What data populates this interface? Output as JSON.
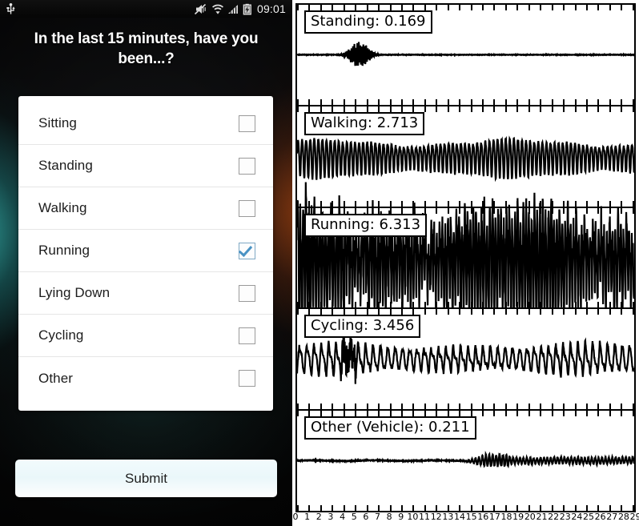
{
  "phone": {
    "statusbar": {
      "time": "09:01",
      "icons": [
        "usb-icon",
        "mute-vibrate-icon",
        "wifi-icon",
        "signal-bars-icon",
        "battery-charging-icon"
      ]
    },
    "question": "In the last 15 minutes, have you been...?",
    "options": [
      {
        "label": "Sitting",
        "checked": false
      },
      {
        "label": "Standing",
        "checked": false
      },
      {
        "label": "Walking",
        "checked": false
      },
      {
        "label": "Running",
        "checked": true
      },
      {
        "label": "Lying Down",
        "checked": false
      },
      {
        "label": "Cycling",
        "checked": false
      },
      {
        "label": "Other",
        "checked": false
      }
    ],
    "submit_label": "Submit",
    "colors": {
      "checkmark": "#4a93c4",
      "card_background": "#ffffff",
      "submit_background": "#eaf7fa",
      "accent_left_glow": "#40d6d0",
      "accent_right_glow": "#cd5414"
    }
  },
  "chart_data": {
    "type": "line",
    "title": "",
    "xlabel": "",
    "ylabel": "",
    "x_tick_labels": [
      "0",
      "1",
      "2",
      "3",
      "4",
      "5",
      "6",
      "7",
      "8",
      "9",
      "10",
      "11",
      "12",
      "13",
      "14",
      "15",
      "16",
      "17",
      "18",
      "19",
      "20",
      "21",
      "22",
      "23",
      "24",
      "25",
      "26",
      "27",
      "28",
      "29"
    ],
    "xlim": [
      0,
      29
    ],
    "grid": false,
    "legend_position": "inside-top-left-box",
    "panels": [
      {
        "label": "Standing: 0.169",
        "activity": "Standing",
        "value": 0.169,
        "waveform": "flat-with-small-burst",
        "amplitude_rel": 0.04,
        "description": "near-flat trace with a small burst of activity around x=5-6"
      },
      {
        "label": "Walking: 2.713",
        "activity": "Walking",
        "value": 2.713,
        "waveform": "regular-oscillation",
        "amplitude_rel": 0.45,
        "description": "dense regular periodic oscillation spanning the full x range"
      },
      {
        "label": "Running: 6.313",
        "activity": "Running",
        "value": 6.313,
        "waveform": "high-amplitude-dense-oscillation",
        "amplitude_rel": 1.15,
        "description": "very dense high amplitude oscillation clipping beyond panel bounds"
      },
      {
        "label": "Cycling: 3.456",
        "activity": "Cycling",
        "value": 3.456,
        "waveform": "sawtooth-like-oscillation",
        "amplitude_rel": 0.38,
        "description": "repetitive sawtooth-like pedalling signature"
      },
      {
        "label": "Other (Vehicle): 0.211",
        "activity": "Other (Vehicle)",
        "value": 0.211,
        "waveform": "flat-with-low-ripple",
        "amplitude_rel": 0.05,
        "description": "near-flat trace with low amplitude ripple from x=15 onward"
      }
    ]
  }
}
